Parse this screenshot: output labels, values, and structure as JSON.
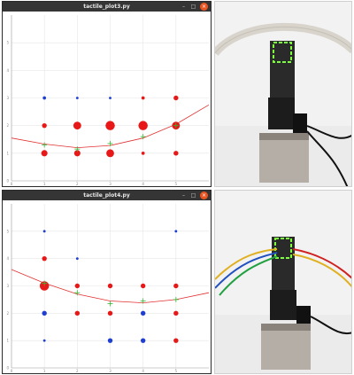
{
  "windows": [
    {
      "title": "tactile_plot3.py",
      "chart_data": {
        "type": "scatter",
        "xlim": [
          0,
          6
        ],
        "ylim": [
          0,
          6
        ],
        "x_ticks": [
          "0",
          "1",
          "2",
          "3",
          "4",
          "5"
        ],
        "y_ticks": [
          "0",
          "1",
          "2",
          "3",
          "4",
          "5"
        ],
        "grid": true,
        "points": [
          {
            "x": 1,
            "y": 3,
            "color": "#1f3fd0",
            "size": 1
          },
          {
            "x": 2,
            "y": 3,
            "color": "#1f3fd0",
            "size": 0.5
          },
          {
            "x": 3,
            "y": 3,
            "color": "#1f3fd0",
            "size": 0.5
          },
          {
            "x": 4,
            "y": 3,
            "color": "#e81818",
            "size": 1
          },
          {
            "x": 5,
            "y": 3,
            "color": "#e81818",
            "size": 2
          },
          {
            "x": 1,
            "y": 2,
            "color": "#e81818",
            "size": 2
          },
          {
            "x": 2,
            "y": 2,
            "color": "#e81818",
            "size": 4
          },
          {
            "x": 3,
            "y": 2,
            "color": "#e81818",
            "size": 5
          },
          {
            "x": 4,
            "y": 2,
            "color": "#e81818",
            "size": 5
          },
          {
            "x": 5,
            "y": 2,
            "color": "#e81818",
            "size": 4
          },
          {
            "x": 1,
            "y": 1,
            "color": "#e81818",
            "size": 3
          },
          {
            "x": 2,
            "y": 1,
            "color": "#e81818",
            "size": 3
          },
          {
            "x": 3,
            "y": 1,
            "color": "#e81818",
            "size": 4
          },
          {
            "x": 4,
            "y": 1,
            "color": "#e81818",
            "size": 1
          },
          {
            "x": 5,
            "y": 1,
            "color": "#e81818",
            "size": 2
          }
        ],
        "markers": [
          {
            "x": 1,
            "y": 1.3
          },
          {
            "x": 2,
            "y": 1.15
          },
          {
            "x": 3,
            "y": 1.35
          },
          {
            "x": 4,
            "y": 1.6
          },
          {
            "x": 5,
            "y": 2
          }
        ],
        "curve": [
          [
            0,
            1.55
          ],
          [
            1,
            1.33
          ],
          [
            2,
            1.2
          ],
          [
            3,
            1.28
          ],
          [
            4,
            1.55
          ],
          [
            5,
            2.05
          ],
          [
            6,
            2.75
          ]
        ]
      }
    },
    {
      "title": "tactile_plot4.py",
      "chart_data": {
        "type": "scatter",
        "xlim": [
          0,
          6
        ],
        "ylim": [
          0,
          6
        ],
        "x_ticks": [
          "0",
          "1",
          "2",
          "3",
          "4",
          "5"
        ],
        "y_ticks": [
          "0",
          "1",
          "2",
          "3",
          "4",
          "5"
        ],
        "grid": true,
        "points": [
          {
            "x": 1,
            "y": 5,
            "color": "#1f3fd0",
            "size": 0.5
          },
          {
            "x": 5,
            "y": 5,
            "color": "#1f3fd0",
            "size": 0.5
          },
          {
            "x": 1,
            "y": 4,
            "color": "#e81818",
            "size": 2
          },
          {
            "x": 2,
            "y": 4,
            "color": "#1f3fd0",
            "size": 0.5
          },
          {
            "x": 1,
            "y": 3,
            "color": "#e81818",
            "size": 5
          },
          {
            "x": 2,
            "y": 3,
            "color": "#e81818",
            "size": 2
          },
          {
            "x": 3,
            "y": 3,
            "color": "#e81818",
            "size": 2
          },
          {
            "x": 4,
            "y": 3,
            "color": "#e81818",
            "size": 2
          },
          {
            "x": 5,
            "y": 3,
            "color": "#e81818",
            "size": 2
          },
          {
            "x": 1,
            "y": 2,
            "color": "#1f3fd0",
            "size": 2
          },
          {
            "x": 2,
            "y": 2,
            "color": "#e81818",
            "size": 2
          },
          {
            "x": 3,
            "y": 2,
            "color": "#e81818",
            "size": 2
          },
          {
            "x": 4,
            "y": 2,
            "color": "#1f3fd0",
            "size": 2
          },
          {
            "x": 5,
            "y": 2,
            "color": "#e81818",
            "size": 2
          },
          {
            "x": 3,
            "y": 1,
            "color": "#1f3fd0",
            "size": 2
          },
          {
            "x": 4,
            "y": 1,
            "color": "#1f3fd0",
            "size": 2
          },
          {
            "x": 5,
            "y": 1,
            "color": "#e81818",
            "size": 2
          },
          {
            "x": 1,
            "y": 1,
            "color": "#1f3fd0",
            "size": 0.5
          }
        ],
        "markers": [
          {
            "x": 1,
            "y": 3.1
          },
          {
            "x": 2,
            "y": 2.75
          },
          {
            "x": 3,
            "y": 2.35
          },
          {
            "x": 4,
            "y": 2.45
          },
          {
            "x": 5,
            "y": 2.5
          }
        ],
        "curve": [
          [
            0,
            3.6
          ],
          [
            1,
            3.1
          ],
          [
            2,
            2.7
          ],
          [
            3,
            2.45
          ],
          [
            4,
            2.38
          ],
          [
            5,
            2.5
          ],
          [
            6,
            2.75
          ]
        ]
      }
    }
  ]
}
